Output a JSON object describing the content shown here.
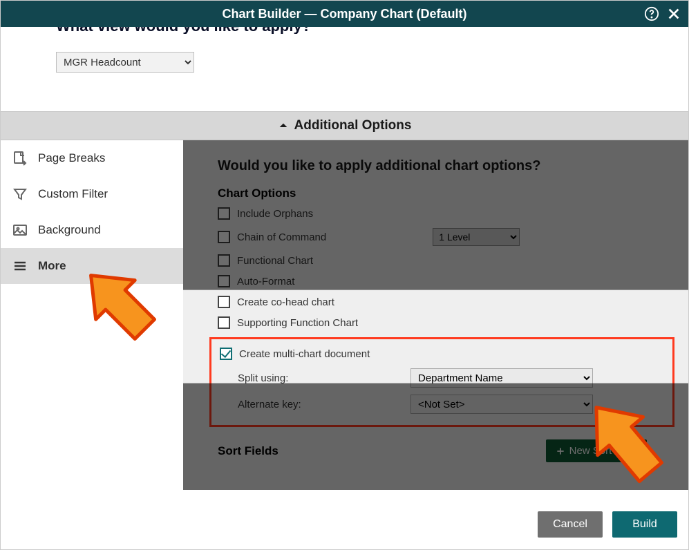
{
  "title": "Chart Builder — Company Chart (Default)",
  "topQuestion": "What view would you like to apply?",
  "viewSelected": "MGR Headcount",
  "accordionLabel": "Additional Options",
  "sidebar": {
    "items": [
      {
        "label": "Page Breaks"
      },
      {
        "label": "Custom Filter"
      },
      {
        "label": "Background"
      },
      {
        "label": "More"
      }
    ]
  },
  "panel": {
    "heading": "Would you like to apply additional chart options?",
    "chartOptionsLabel": "Chart Options",
    "includeOrphans": "Include Orphans",
    "chainOfCommand": "Chain of Command",
    "levelsSelected": "1 Level",
    "functionalChart": "Functional Chart",
    "autoFormat": "Auto-Format",
    "coHead": "Create co-head chart",
    "supportingFn": "Supporting Function Chart",
    "multiChart": "Create multi-chart document",
    "splitUsingLabel": "Split using:",
    "splitUsingValue": "Department Name",
    "altKeyLabel": "Alternate key:",
    "altKeyValue": "<Not Set>",
    "sortFieldsLabel": "Sort Fields",
    "newSortField": "New Sort Field"
  },
  "footer": {
    "cancel": "Cancel",
    "build": "Build"
  }
}
